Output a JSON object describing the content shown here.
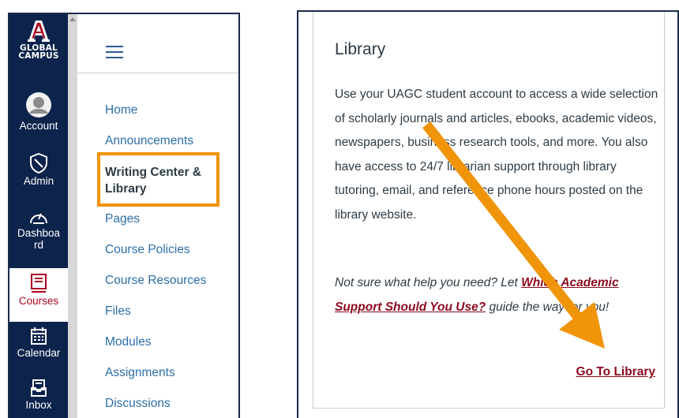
{
  "global_nav": {
    "logo_text_line1": "GLOBAL",
    "logo_text_line2": "CAMPUS",
    "items": [
      {
        "label": "Account",
        "icon": "account-avatar-icon"
      },
      {
        "label": "Admin",
        "icon": "admin-shield-icon"
      },
      {
        "label": "Dashboa",
        "label_line2": "rd",
        "icon": "dashboard-gauge-icon"
      },
      {
        "label": "Courses",
        "icon": "courses-book-icon"
      },
      {
        "label": "Calendar",
        "icon": "calendar-icon"
      },
      {
        "label": "Inbox",
        "icon": "inbox-icon"
      }
    ]
  },
  "course_nav": {
    "links": [
      "Home",
      "Announcements",
      "Writing Center &",
      "Pages",
      "Course Policies",
      "Course Resources",
      "Files",
      "Modules",
      "Assignments",
      "Discussions"
    ],
    "active_line1": "Writing Center &",
    "active_line2": "Library"
  },
  "library_card": {
    "title": "Library",
    "body": "Use your UAGC student account to access a wide selection of scholarly journals and articles, ebooks, academic videos, newspapers, business research tools, and more. You also have access to 24/7 librarian support through library tutoring, email, and reference phone hours posted on the library website.",
    "help_prefix": "Not sure what help you need? Let ",
    "help_link": "Which Academic Support Should You Use?",
    "help_suffix": " guide the way for you!",
    "action_link": "Go To Library"
  },
  "colors": {
    "nav_bg": "#0c234b",
    "active_red": "#ab0520",
    "link_blue": "#2d6fa8",
    "highlight_orange": "#f0940a",
    "card_link": "#8b0a1d"
  }
}
